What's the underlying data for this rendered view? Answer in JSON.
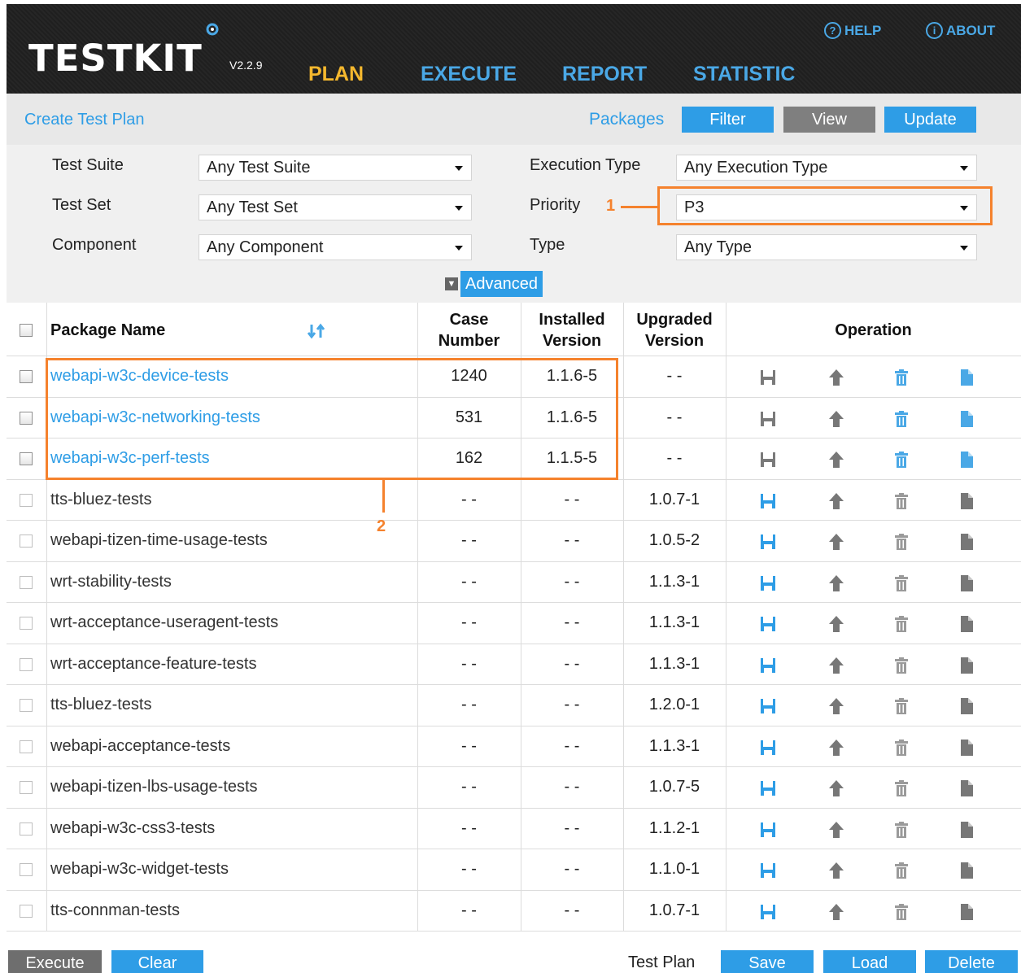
{
  "header": {
    "logo": "TESTKIT",
    "version": "V2.2.9",
    "nav": {
      "plan": "PLAN",
      "execute": "EXECUTE",
      "report": "REPORT",
      "statistic": "STATISTIC"
    },
    "help": "HELP",
    "about": "ABOUT",
    "help_glyph": "?",
    "about_glyph": "i"
  },
  "toolbar": {
    "create_link": "Create Test Plan",
    "packages_label": "Packages",
    "filter": "Filter",
    "view": "View",
    "update": "Update"
  },
  "filters": {
    "test_suite": {
      "label": "Test Suite",
      "value": "Any Test Suite"
    },
    "test_set": {
      "label": "Test Set",
      "value": "Any Test Set"
    },
    "component": {
      "label": "Component",
      "value": "Any Component"
    },
    "execution_type": {
      "label": "Execution Type",
      "value": "Any Execution Type"
    },
    "priority": {
      "label": "Priority",
      "value": "P3"
    },
    "type": {
      "label": "Type",
      "value": "Any Type"
    },
    "advanced": "Advanced",
    "annotation_1": "1"
  },
  "table": {
    "headers": {
      "package_name": "Package Name",
      "case_number_1": "Case",
      "case_number_2": "Number",
      "installed_1": "Installed",
      "installed_2": "Version",
      "upgraded_1": "Upgraded",
      "upgraded_2": "Version",
      "operation": "Operation"
    },
    "annotation_2": "2",
    "rows": [
      {
        "name": "webapi-w3c-device-tests",
        "case": "1240",
        "installed": "1.1.6-5",
        "upgraded": "- -",
        "installed_pkg": true
      },
      {
        "name": "webapi-w3c-networking-tests",
        "case": "531",
        "installed": "1.1.6-5",
        "upgraded": "- -",
        "installed_pkg": true
      },
      {
        "name": "webapi-w3c-perf-tests",
        "case": "162",
        "installed": "1.1.5-5",
        "upgraded": "- -",
        "installed_pkg": true
      },
      {
        "name": "tts-bluez-tests",
        "case": "- -",
        "installed": "- -",
        "upgraded": "1.0.7-1",
        "installed_pkg": false
      },
      {
        "name": "webapi-tizen-time-usage-tests",
        "case": "- -",
        "installed": "- -",
        "upgraded": "1.0.5-2",
        "installed_pkg": false
      },
      {
        "name": "wrt-stability-tests",
        "case": "- -",
        "installed": "- -",
        "upgraded": "1.1.3-1",
        "installed_pkg": false
      },
      {
        "name": "wrt-acceptance-useragent-tests",
        "case": "- -",
        "installed": "- -",
        "upgraded": "1.1.3-1",
        "installed_pkg": false
      },
      {
        "name": "wrt-acceptance-feature-tests",
        "case": "- -",
        "installed": "- -",
        "upgraded": "1.1.3-1",
        "installed_pkg": false
      },
      {
        "name": "tts-bluez-tests",
        "case": "- -",
        "installed": "- -",
        "upgraded": "1.2.0-1",
        "installed_pkg": false
      },
      {
        "name": "webapi-acceptance-tests",
        "case": "- -",
        "installed": "- -",
        "upgraded": "1.1.3-1",
        "installed_pkg": false
      },
      {
        "name": "webapi-tizen-lbs-usage-tests",
        "case": "- -",
        "installed": "- -",
        "upgraded": "1.0.7-5",
        "installed_pkg": false
      },
      {
        "name": "webapi-w3c-css3-tests",
        "case": "- -",
        "installed": "- -",
        "upgraded": "1.1.2-1",
        "installed_pkg": false
      },
      {
        "name": "webapi-w3c-widget-tests",
        "case": "- -",
        "installed": "- -",
        "upgraded": "1.1.0-1",
        "installed_pkg": false
      },
      {
        "name": "tts-connman-tests",
        "case": "- -",
        "installed": "- -",
        "upgraded": "1.0.7-1",
        "installed_pkg": false
      }
    ]
  },
  "footer": {
    "execute": "Execute",
    "clear": "Clear",
    "test_plan_label": "Test Plan",
    "save": "Save",
    "load": "Load",
    "delete": "Delete"
  },
  "colors": {
    "accent_blue": "#2e9de6",
    "highlight_orange": "#f5822d",
    "nav_active": "#f5b82e"
  }
}
